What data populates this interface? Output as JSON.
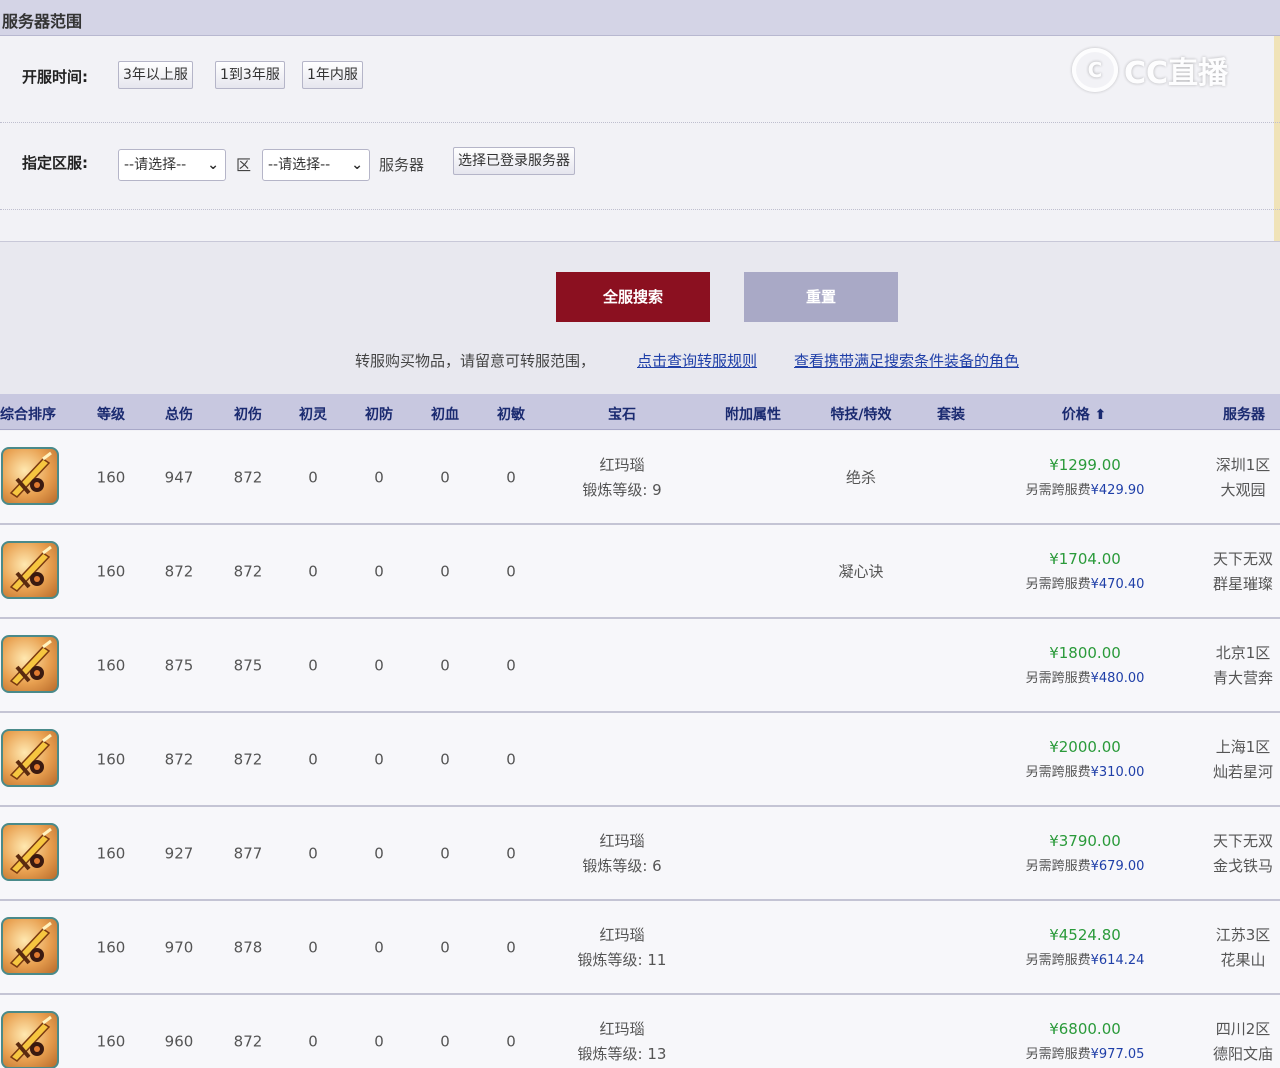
{
  "section_title": "服务器范围",
  "open_time": {
    "label": "开服时间:",
    "options": [
      "3年以上服",
      "1到3年服",
      "1年内服"
    ]
  },
  "server": {
    "label": "指定区服:",
    "zone_select": "--请选择--",
    "zone_label": "区",
    "server_select": "--请选择--",
    "server_label": "服务器",
    "choose_logged_button": "选择已登录服务器"
  },
  "watermark": {
    "logo_text": "CC直播"
  },
  "actions": {
    "search_all": "全服搜索",
    "reset": "重置"
  },
  "notice": {
    "text": "转服购买物品，请留意可转服范围，",
    "link_rules": "点击查询转服规则",
    "link_match": "查看携带满足搜索条件装备的角色"
  },
  "table": {
    "headers": [
      "综合排序",
      "等级",
      "总伤",
      "初伤",
      "初灵",
      "初防",
      "初血",
      "初敏",
      "宝石",
      "附加属性",
      "特技/特效",
      "套装",
      "价格 ⬆",
      "服务器"
    ],
    "rows": [
      {
        "level": "160",
        "total": "947",
        "init_dmg": "872",
        "init_ling": "0",
        "init_def": "0",
        "init_hp": "0",
        "init_agi": "0",
        "gem": "红玛瑙",
        "gem_level": "锻炼等级: 9",
        "extra": "",
        "skill": "绝杀",
        "suit": "",
        "price": "¥1299.00",
        "fee_label": "另需跨服费",
        "fee": "¥429.90",
        "server1": "深圳1区",
        "server2": "大观园"
      },
      {
        "level": "160",
        "total": "872",
        "init_dmg": "872",
        "init_ling": "0",
        "init_def": "0",
        "init_hp": "0",
        "init_agi": "0",
        "gem": "",
        "gem_level": "",
        "extra": "",
        "skill": "凝心诀",
        "suit": "",
        "price": "¥1704.00",
        "fee_label": "另需跨服费",
        "fee": "¥470.40",
        "server1": "天下无双",
        "server2": "群星璀璨"
      },
      {
        "level": "160",
        "total": "875",
        "init_dmg": "875",
        "init_ling": "0",
        "init_def": "0",
        "init_hp": "0",
        "init_agi": "0",
        "gem": "",
        "gem_level": "",
        "extra": "",
        "skill": "",
        "suit": "",
        "price": "¥1800.00",
        "fee_label": "另需跨服费",
        "fee": "¥480.00",
        "server1": "北京1区",
        "server2": "青大营奔"
      },
      {
        "level": "160",
        "total": "872",
        "init_dmg": "872",
        "init_ling": "0",
        "init_def": "0",
        "init_hp": "0",
        "init_agi": "0",
        "gem": "",
        "gem_level": "",
        "extra": "",
        "skill": "",
        "suit": "",
        "price": "¥2000.00",
        "fee_label": "另需跨服费",
        "fee": "¥310.00",
        "server1": "上海1区",
        "server2": "灿若星河"
      },
      {
        "level": "160",
        "total": "927",
        "init_dmg": "877",
        "init_ling": "0",
        "init_def": "0",
        "init_hp": "0",
        "init_agi": "0",
        "gem": "红玛瑙",
        "gem_level": "锻炼等级: 6",
        "extra": "",
        "skill": "",
        "suit": "",
        "price": "¥3790.00",
        "fee_label": "另需跨服费",
        "fee": "¥679.00",
        "server1": "天下无双",
        "server2": "金戈铁马"
      },
      {
        "level": "160",
        "total": "970",
        "init_dmg": "878",
        "init_ling": "0",
        "init_def": "0",
        "init_hp": "0",
        "init_agi": "0",
        "gem": "红玛瑙",
        "gem_level": "锻炼等级: 11",
        "extra": "",
        "skill": "",
        "suit": "",
        "price": "¥4524.80",
        "fee_label": "另需跨服费",
        "fee": "¥614.24",
        "server1": "江苏3区",
        "server2": "花果山"
      },
      {
        "level": "160",
        "total": "960",
        "init_dmg": "872",
        "init_ling": "0",
        "init_def": "0",
        "init_hp": "0",
        "init_agi": "0",
        "gem": "红玛瑙",
        "gem_level": "锻炼等级: 13",
        "extra": "",
        "skill": "",
        "suit": "",
        "price": "¥6800.00",
        "fee_label": "另需跨服费",
        "fee": "¥977.05",
        "server1": "四川2区",
        "server2": "德阳文庙"
      }
    ]
  },
  "colors": {
    "accent": "#8b1020",
    "price": "#2a9a3a",
    "link": "#1f3fa8",
    "header_bg": "#c8c8e0"
  }
}
